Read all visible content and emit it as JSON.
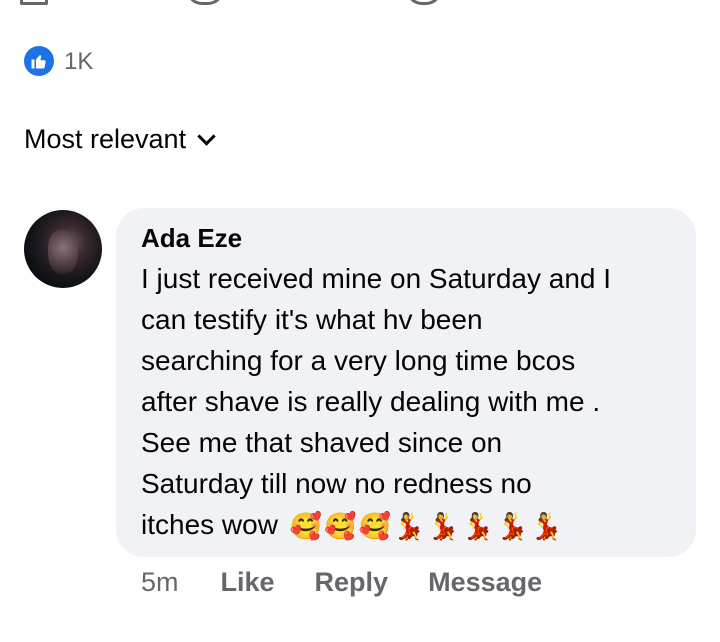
{
  "reactions": {
    "icon": "thumbs-up-icon",
    "count": "1K",
    "color": "#1d72e8"
  },
  "sort": {
    "label": "Most relevant",
    "icon": "chevron-down-icon"
  },
  "comment": {
    "author": "Ada Eze",
    "lines": [
      "I just received mine on Saturday and I",
      "can testify it's what hv been",
      "searching for a very long time bcos",
      "after shave is really dealing with me .",
      "See me that shaved since on",
      "Saturday till now no redness no",
      "itches wow"
    ],
    "emojis": [
      "🥰",
      "🥰",
      "🥰",
      "💃",
      "💃",
      "💃",
      "💃",
      "💃"
    ],
    "time": "5m",
    "actions": {
      "like": "Like",
      "reply": "Reply",
      "message": "Message"
    }
  }
}
